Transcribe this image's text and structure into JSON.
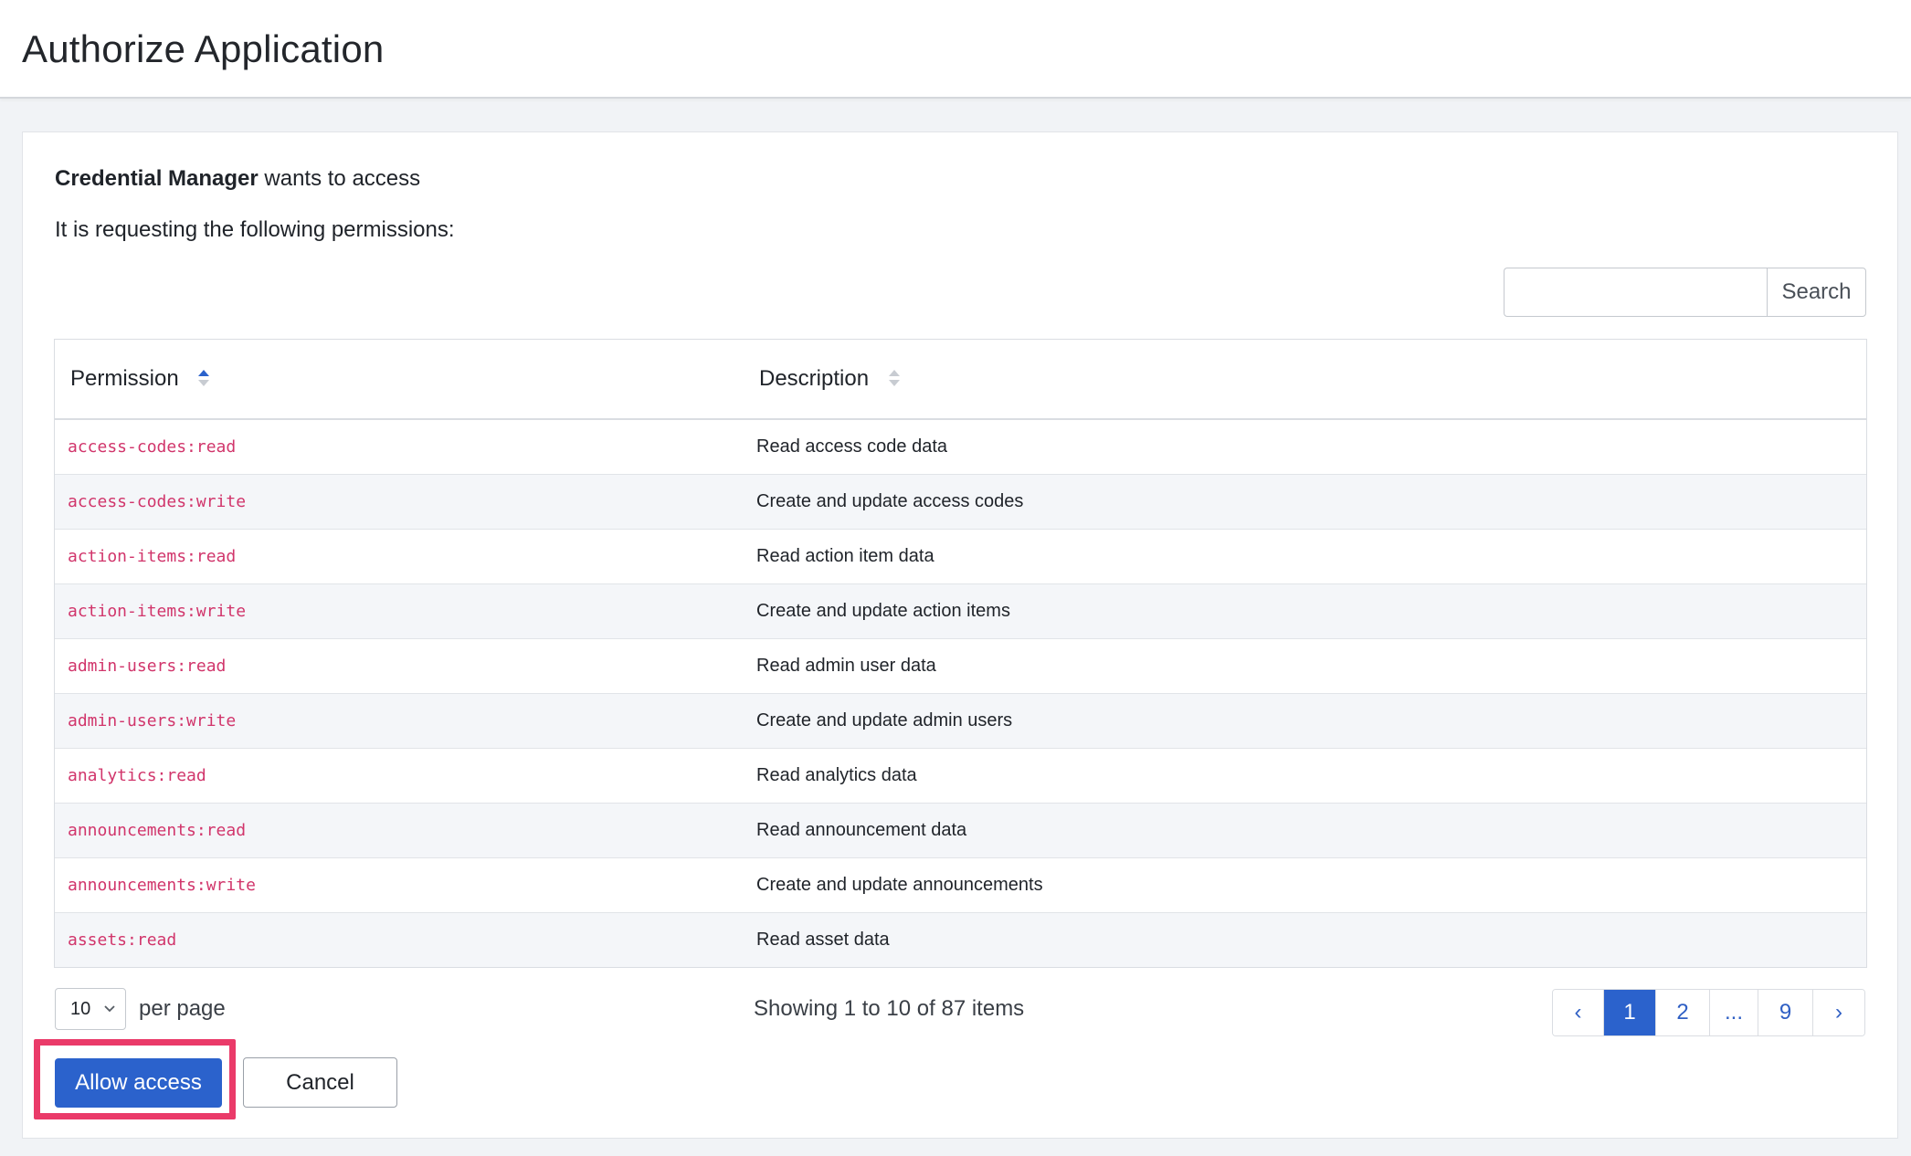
{
  "header": {
    "title": "Authorize Application"
  },
  "intro": {
    "app_name": "Credential Manager",
    "wants_text": " wants to access",
    "request_text": "It is requesting the following permissions:"
  },
  "search": {
    "placeholder": "",
    "value": "",
    "button_label": "Search"
  },
  "table": {
    "columns": [
      {
        "label": "Permission",
        "sort": "ascending"
      },
      {
        "label": "Description",
        "sort": "none"
      }
    ],
    "rows": [
      {
        "permission": "access-codes:read",
        "description": "Read access code data"
      },
      {
        "permission": "access-codes:write",
        "description": "Create and update access codes"
      },
      {
        "permission": "action-items:read",
        "description": "Read action item data"
      },
      {
        "permission": "action-items:write",
        "description": "Create and update action items"
      },
      {
        "permission": "admin-users:read",
        "description": "Read admin user data"
      },
      {
        "permission": "admin-users:write",
        "description": "Create and update admin users"
      },
      {
        "permission": "analytics:read",
        "description": "Read analytics data"
      },
      {
        "permission": "announcements:read",
        "description": "Read announcement data"
      },
      {
        "permission": "announcements:write",
        "description": "Create and update announcements"
      },
      {
        "permission": "assets:read",
        "description": "Read asset data"
      }
    ]
  },
  "pagination": {
    "per_page_value": "10",
    "per_page_label": "per page",
    "showing_text": "Showing 1 to 10 of 87 items",
    "prev_label": "‹",
    "next_label": "›",
    "pages": [
      "1",
      "2",
      "...",
      "9"
    ],
    "current_page": "1"
  },
  "actions": {
    "allow_label": "Allow access",
    "cancel_label": "Cancel"
  },
  "colors": {
    "primary": "#2b62cc",
    "highlight": "#ea3a69",
    "code_text": "#d1356b"
  },
  "icons": {
    "sort_ascending": "sort-ascending-icon",
    "sort_none": "sort-icon",
    "chevron": "chevron-down-icon"
  }
}
